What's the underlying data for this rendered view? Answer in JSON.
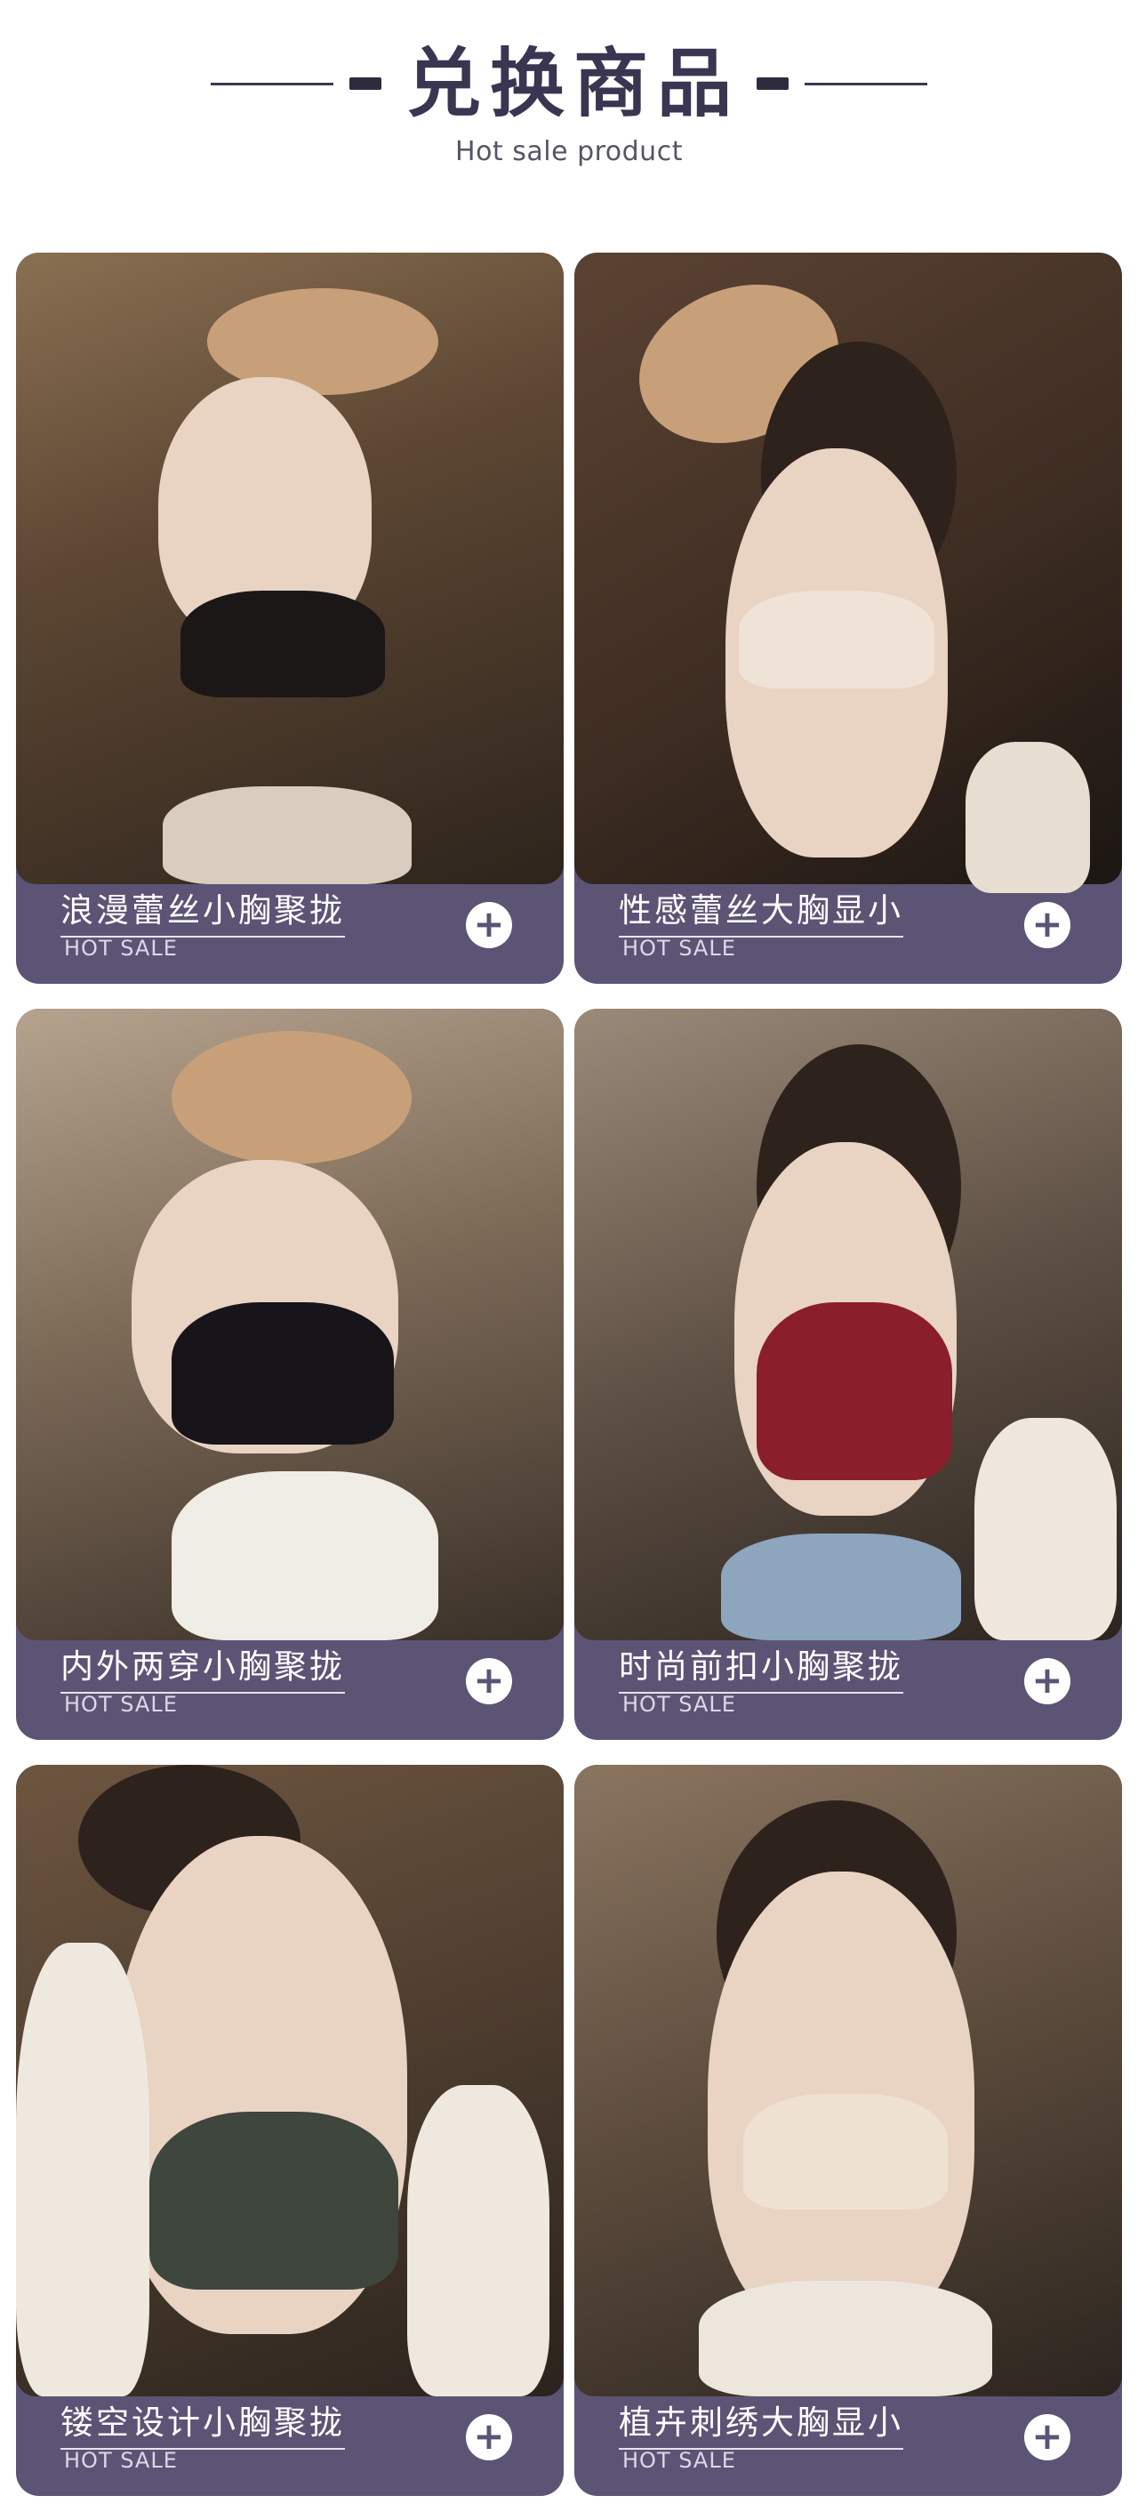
{
  "header": {
    "title": "兑换商品",
    "subtitle": "Hot sale product"
  },
  "products": [
    {
      "name": "浪漫蕾丝小胸聚拢",
      "tag": "HOT SALE",
      "action_icon": "plus-icon"
    },
    {
      "name": "性感蕾丝大胸显小",
      "tag": "HOT SALE",
      "action_icon": "plus-icon"
    },
    {
      "name": "内外两穿小胸聚拢",
      "tag": "HOT SALE",
      "action_icon": "plus-icon"
    },
    {
      "name": "时尚前扣小胸聚拢",
      "tag": "HOT SALE",
      "action_icon": "plus-icon"
    },
    {
      "name": "镂空设计小胸聚拢",
      "tag": "HOT SALE",
      "action_icon": "plus-icon"
    },
    {
      "name": "植卉刺绣大胸显小",
      "tag": "HOT SALE",
      "action_icon": "plus-icon"
    }
  ],
  "colors": {
    "card_bar": "#5c5475",
    "title": "#3a3550",
    "plus_bg": "#ffffff"
  }
}
